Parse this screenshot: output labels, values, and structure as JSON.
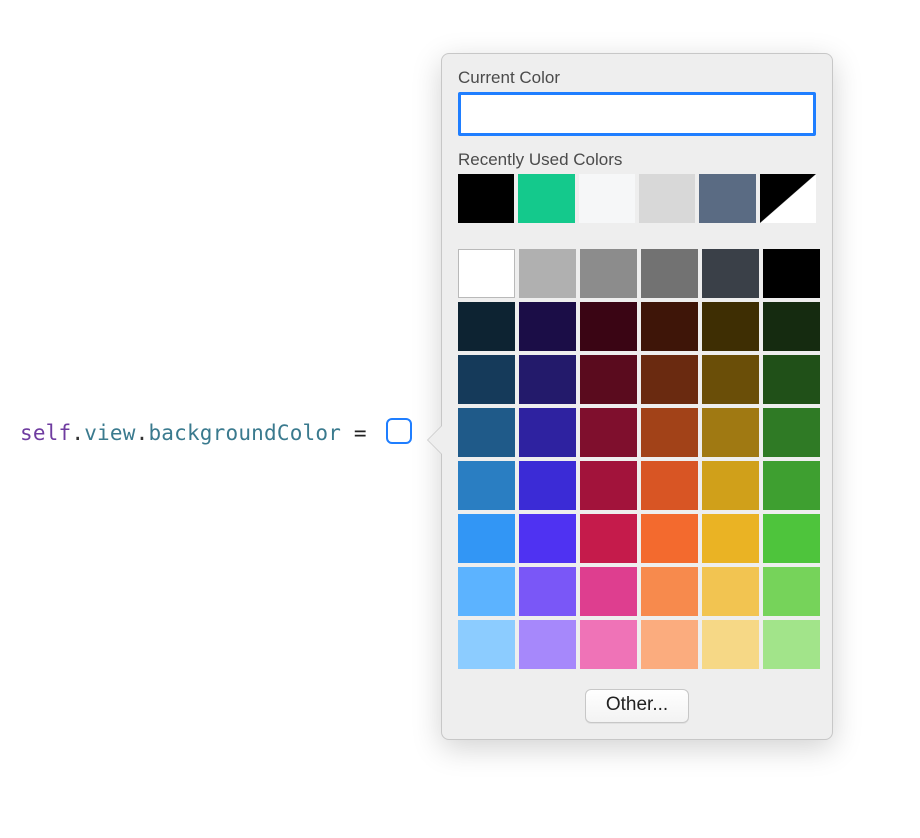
{
  "code": {
    "self": "self",
    "dot1": ".",
    "view": "view",
    "dot2": ".",
    "prop": "backgroundColor",
    "eq": " = "
  },
  "popover": {
    "current_label": "Current Color",
    "current_color": "#ffffff",
    "recent_label": "Recently Used Colors",
    "recent_colors": [
      "#000000",
      "#14c98c",
      "#f6f7f8",
      "#d8d8d8",
      "#5a6b83",
      "split"
    ],
    "palette": [
      "#ffffff",
      "#b0b0b0",
      "#8c8c8c",
      "#727272",
      "#3a4048",
      "#000000",
      "#0d2332",
      "#1b0d47",
      "#3a0514",
      "#3e1508",
      "#3e2e03",
      "#152b10",
      "#153a5a",
      "#231a6b",
      "#5a0b1e",
      "#6a2a10",
      "#6a4e08",
      "#205018",
      "#1f5a89",
      "#2e22a0",
      "#7f0f2d",
      "#a24218",
      "#a07912",
      "#2f7a25",
      "#2a7ec2",
      "#3b2bd6",
      "#a2133b",
      "#d85524",
      "#d0a01a",
      "#3e9f30",
      "#3296f5",
      "#4f32f2",
      "#c51b4b",
      "#f36a2e",
      "#eab324",
      "#4ec43c",
      "#5cb3ff",
      "#7a57f7",
      "#de3e8f",
      "#f78a4d",
      "#f2c451",
      "#76d35a",
      "#8cccff",
      "#a688fb",
      "#ef73b7",
      "#fbac7e",
      "#f6d886",
      "#a2e48a"
    ],
    "other_label": "Other..."
  }
}
